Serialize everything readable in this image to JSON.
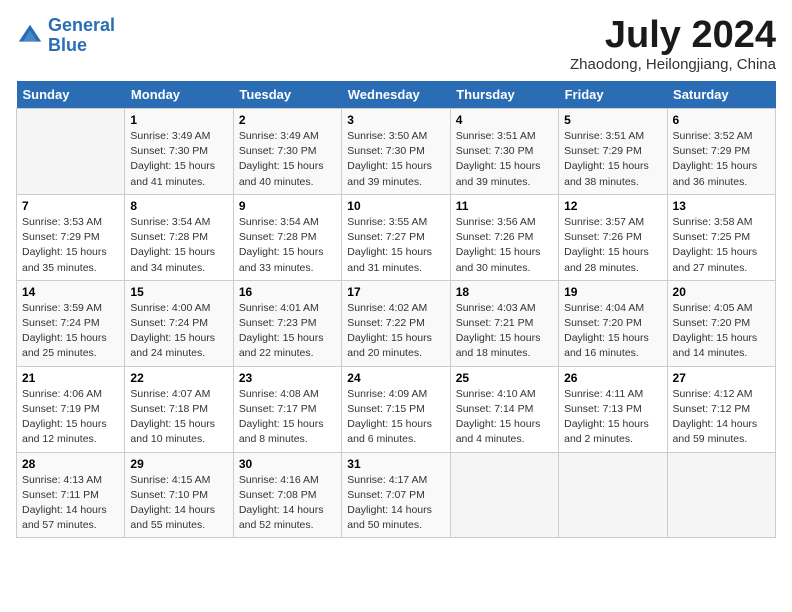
{
  "header": {
    "logo_line1": "General",
    "logo_line2": "Blue",
    "month_year": "July 2024",
    "location": "Zhaodong, Heilongjiang, China"
  },
  "days_of_week": [
    "Sunday",
    "Monday",
    "Tuesday",
    "Wednesday",
    "Thursday",
    "Friday",
    "Saturday"
  ],
  "weeks": [
    [
      {
        "day": "",
        "info": ""
      },
      {
        "day": "1",
        "info": "Sunrise: 3:49 AM\nSunset: 7:30 PM\nDaylight: 15 hours\nand 41 minutes."
      },
      {
        "day": "2",
        "info": "Sunrise: 3:49 AM\nSunset: 7:30 PM\nDaylight: 15 hours\nand 40 minutes."
      },
      {
        "day": "3",
        "info": "Sunrise: 3:50 AM\nSunset: 7:30 PM\nDaylight: 15 hours\nand 39 minutes."
      },
      {
        "day": "4",
        "info": "Sunrise: 3:51 AM\nSunset: 7:30 PM\nDaylight: 15 hours\nand 39 minutes."
      },
      {
        "day": "5",
        "info": "Sunrise: 3:51 AM\nSunset: 7:29 PM\nDaylight: 15 hours\nand 38 minutes."
      },
      {
        "day": "6",
        "info": "Sunrise: 3:52 AM\nSunset: 7:29 PM\nDaylight: 15 hours\nand 36 minutes."
      }
    ],
    [
      {
        "day": "7",
        "info": "Sunrise: 3:53 AM\nSunset: 7:29 PM\nDaylight: 15 hours\nand 35 minutes."
      },
      {
        "day": "8",
        "info": "Sunrise: 3:54 AM\nSunset: 7:28 PM\nDaylight: 15 hours\nand 34 minutes."
      },
      {
        "day": "9",
        "info": "Sunrise: 3:54 AM\nSunset: 7:28 PM\nDaylight: 15 hours\nand 33 minutes."
      },
      {
        "day": "10",
        "info": "Sunrise: 3:55 AM\nSunset: 7:27 PM\nDaylight: 15 hours\nand 31 minutes."
      },
      {
        "day": "11",
        "info": "Sunrise: 3:56 AM\nSunset: 7:26 PM\nDaylight: 15 hours\nand 30 minutes."
      },
      {
        "day": "12",
        "info": "Sunrise: 3:57 AM\nSunset: 7:26 PM\nDaylight: 15 hours\nand 28 minutes."
      },
      {
        "day": "13",
        "info": "Sunrise: 3:58 AM\nSunset: 7:25 PM\nDaylight: 15 hours\nand 27 minutes."
      }
    ],
    [
      {
        "day": "14",
        "info": "Sunrise: 3:59 AM\nSunset: 7:24 PM\nDaylight: 15 hours\nand 25 minutes."
      },
      {
        "day": "15",
        "info": "Sunrise: 4:00 AM\nSunset: 7:24 PM\nDaylight: 15 hours\nand 24 minutes."
      },
      {
        "day": "16",
        "info": "Sunrise: 4:01 AM\nSunset: 7:23 PM\nDaylight: 15 hours\nand 22 minutes."
      },
      {
        "day": "17",
        "info": "Sunrise: 4:02 AM\nSunset: 7:22 PM\nDaylight: 15 hours\nand 20 minutes."
      },
      {
        "day": "18",
        "info": "Sunrise: 4:03 AM\nSunset: 7:21 PM\nDaylight: 15 hours\nand 18 minutes."
      },
      {
        "day": "19",
        "info": "Sunrise: 4:04 AM\nSunset: 7:20 PM\nDaylight: 15 hours\nand 16 minutes."
      },
      {
        "day": "20",
        "info": "Sunrise: 4:05 AM\nSunset: 7:20 PM\nDaylight: 15 hours\nand 14 minutes."
      }
    ],
    [
      {
        "day": "21",
        "info": "Sunrise: 4:06 AM\nSunset: 7:19 PM\nDaylight: 15 hours\nand 12 minutes."
      },
      {
        "day": "22",
        "info": "Sunrise: 4:07 AM\nSunset: 7:18 PM\nDaylight: 15 hours\nand 10 minutes."
      },
      {
        "day": "23",
        "info": "Sunrise: 4:08 AM\nSunset: 7:17 PM\nDaylight: 15 hours\nand 8 minutes."
      },
      {
        "day": "24",
        "info": "Sunrise: 4:09 AM\nSunset: 7:15 PM\nDaylight: 15 hours\nand 6 minutes."
      },
      {
        "day": "25",
        "info": "Sunrise: 4:10 AM\nSunset: 7:14 PM\nDaylight: 15 hours\nand 4 minutes."
      },
      {
        "day": "26",
        "info": "Sunrise: 4:11 AM\nSunset: 7:13 PM\nDaylight: 15 hours\nand 2 minutes."
      },
      {
        "day": "27",
        "info": "Sunrise: 4:12 AM\nSunset: 7:12 PM\nDaylight: 14 hours\nand 59 minutes."
      }
    ],
    [
      {
        "day": "28",
        "info": "Sunrise: 4:13 AM\nSunset: 7:11 PM\nDaylight: 14 hours\nand 57 minutes."
      },
      {
        "day": "29",
        "info": "Sunrise: 4:15 AM\nSunset: 7:10 PM\nDaylight: 14 hours\nand 55 minutes."
      },
      {
        "day": "30",
        "info": "Sunrise: 4:16 AM\nSunset: 7:08 PM\nDaylight: 14 hours\nand 52 minutes."
      },
      {
        "day": "31",
        "info": "Sunrise: 4:17 AM\nSunset: 7:07 PM\nDaylight: 14 hours\nand 50 minutes."
      },
      {
        "day": "",
        "info": ""
      },
      {
        "day": "",
        "info": ""
      },
      {
        "day": "",
        "info": ""
      }
    ]
  ]
}
